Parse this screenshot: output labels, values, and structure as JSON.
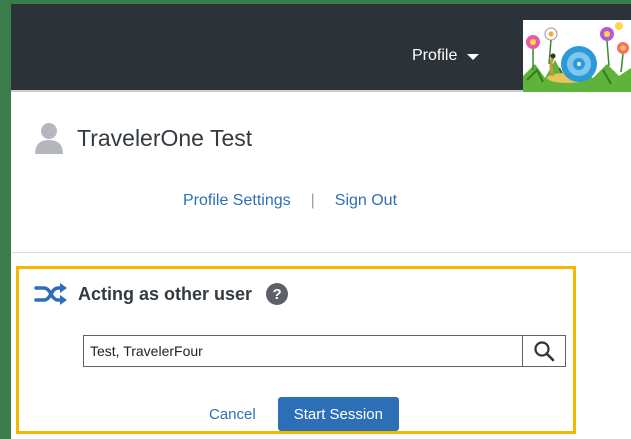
{
  "header": {
    "profile_label": "Profile"
  },
  "user": {
    "name": "TravelerOne Test",
    "icon": "user-silhouette-icon"
  },
  "links": {
    "profile_settings": "Profile Settings",
    "separator": "|",
    "sign_out": "Sign Out"
  },
  "acting": {
    "title": "Acting as other user",
    "help_symbol": "?",
    "search_value": "Test, TravelerFour",
    "cancel_label": "Cancel",
    "start_label": "Start Session"
  },
  "colors": {
    "topbar": "#2c3338",
    "frame": "#3a7d4b",
    "link": "#2d6fb7",
    "highlight_border": "#f2b900"
  }
}
